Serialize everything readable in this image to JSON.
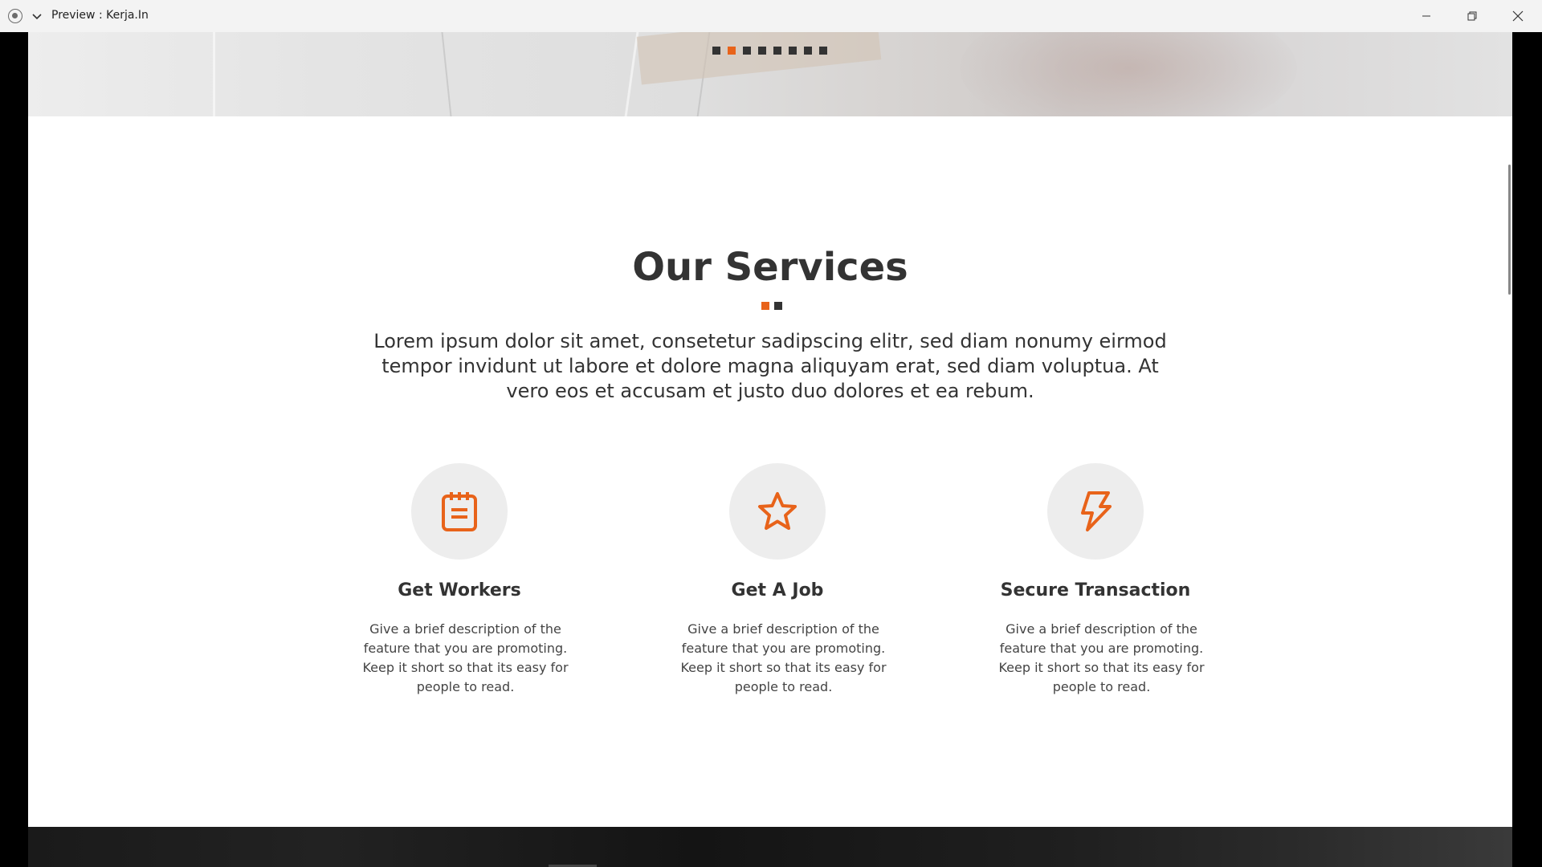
{
  "window": {
    "title": "Preview : Kerja.In"
  },
  "hero": {
    "slide_count": 8,
    "active_slide": 2
  },
  "services": {
    "title": "Our Services",
    "description": "Lorem ipsum dolor sit amet, consetetur sadipscing elitr, sed diam nonumy eirmod tempor invidunt ut labore et dolore magna aliquyam erat, sed diam voluptua. At vero eos et accusam et justo duo dolores et ea rebum.",
    "features": [
      {
        "icon": "notepad-icon",
        "title": "Get Workers",
        "text": "Give a brief description of the feature that you are promoting. Keep it short so that its easy for people to read."
      },
      {
        "icon": "star-icon",
        "title": "Get A Job",
        "text": "Give a brief description of the feature that you are promoting. Keep it short so that its easy for people to read."
      },
      {
        "icon": "lightning-icon",
        "title": "Secure Transaction",
        "text": "Give a brief description of the feature that you are promoting. Keep it short so that its easy for people to read."
      }
    ]
  },
  "colors": {
    "accent": "#e8631a",
    "text": "#333333",
    "icon_circle": "#ededed"
  }
}
